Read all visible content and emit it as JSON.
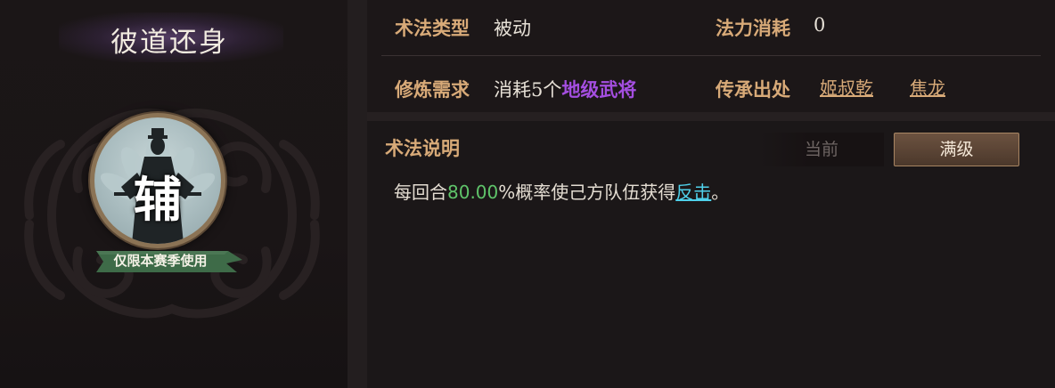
{
  "skill": {
    "name": "彼道还身",
    "role_char": "辅",
    "season_tag": "仅限本赛季使用"
  },
  "info": {
    "type_label": "术法类型",
    "type_value": "被动",
    "cost_label": "法力消耗",
    "cost_value": "0",
    "req_label": "修炼需求",
    "req_prefix": "消耗5个",
    "req_highlight": "地级武将",
    "origin_label": "传承出处",
    "origin_links": [
      "姬叔乾",
      "焦龙"
    ]
  },
  "description": {
    "header": "术法说明",
    "tabs": [
      {
        "label": "当前",
        "active": false
      },
      {
        "label": "满级",
        "active": true
      }
    ],
    "text_prefix": "每回合",
    "probability": "80.00",
    "text_middle": "%概率使己方队伍获得",
    "keyword": "反击",
    "text_suffix": "。"
  },
  "colors": {
    "label_gold": "#d8aa78",
    "highlight_purple": "#a44ee0",
    "value_green": "#5fc46a",
    "keyword_cyan": "#4fd0ea",
    "ribbon_green": "#3e6b48"
  },
  "icons": {
    "portrait": "robed-strategist-portrait",
    "ornament": "cloud-swirl-ornament"
  }
}
